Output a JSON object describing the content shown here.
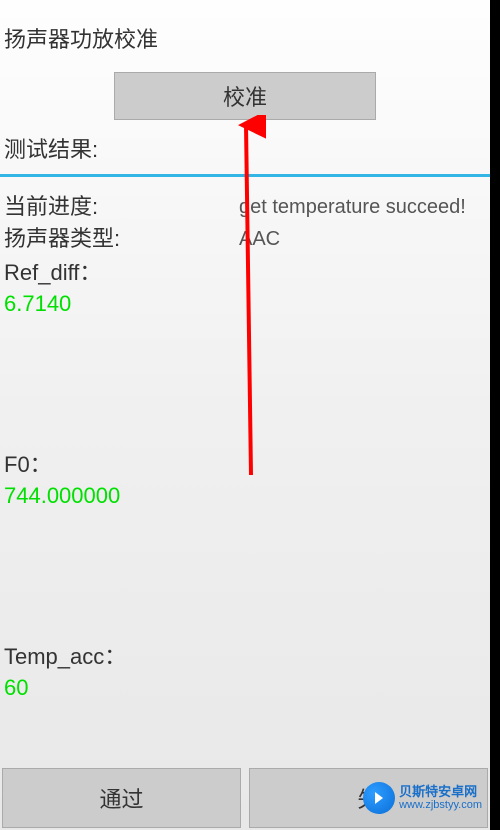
{
  "title": "扬声器功放校准",
  "calibrate_button": "校准",
  "test_result_label": "测试结果:",
  "progress": {
    "label": "当前进度:",
    "value": "get temperature succeed!"
  },
  "speaker_type": {
    "label": "扬声器类型:",
    "value": "AAC"
  },
  "ref_diff": {
    "label": "Ref_diff：",
    "value": "6.7140"
  },
  "f0": {
    "label": "F0：",
    "value": "744.000000"
  },
  "temp_acc": {
    "label": "Temp_acc：",
    "value": "60"
  },
  "bottom": {
    "pass": "通过",
    "fail": "失"
  },
  "watermark": {
    "name": "贝斯特安卓网",
    "url": "www.zjbstyy.com"
  }
}
